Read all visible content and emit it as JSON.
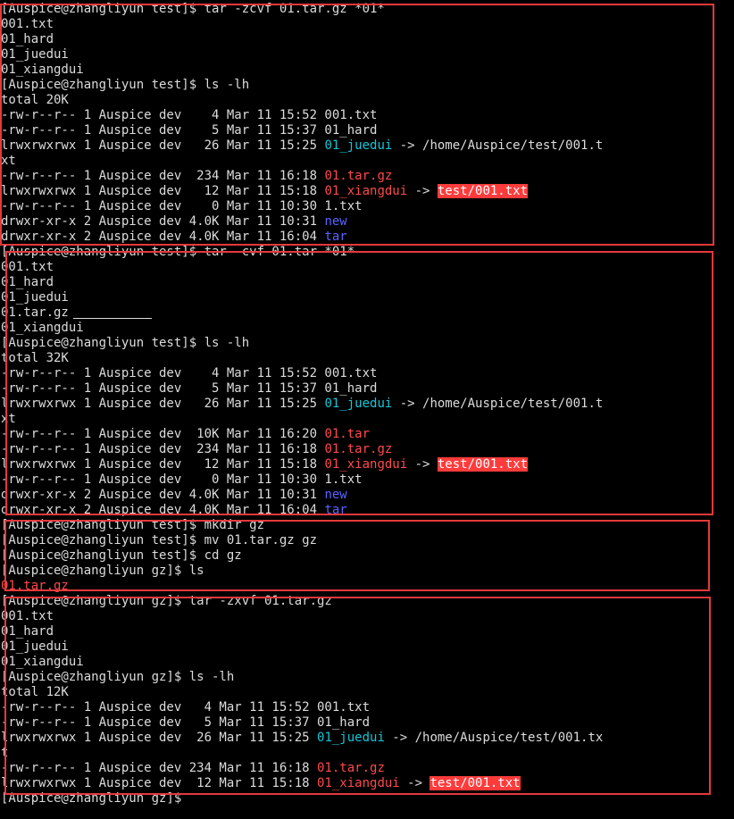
{
  "terminal": {
    "lines": [
      [
        {
          "t": "[Auspice@zhangliyun test]$ tar -zcvf 01.tar.gz *01*"
        }
      ],
      [
        {
          "t": "001.txt"
        }
      ],
      [
        {
          "t": "01_hard"
        }
      ],
      [
        {
          "t": "01_juedui"
        }
      ],
      [
        {
          "t": "01_xiangdui"
        }
      ],
      [
        {
          "t": "[Auspice@zhangliyun test]$ ls -lh"
        }
      ],
      [
        {
          "t": "total 20K"
        }
      ],
      [
        {
          "t": "-rw-r--r-- 1 Auspice dev    4 Mar 11 15:52 001.txt"
        }
      ],
      [
        {
          "t": "-rw-r--r-- 1 Auspice dev    5 Mar 11 15:37 01_hard"
        }
      ],
      [
        {
          "t": "lrwxrwxrwx 1 Auspice dev   26 Mar 11 15:25 "
        },
        {
          "t": "01_juedui",
          "c": "cyan"
        },
        {
          "t": " -> /home/Auspice/test/001.t"
        }
      ],
      [
        {
          "t": "xt"
        }
      ],
      [
        {
          "t": "-rw-r--r-- 1 Auspice dev  234 Mar 11 16:18 "
        },
        {
          "t": "01.tar.gz",
          "c": "red"
        }
      ],
      [
        {
          "t": "lrwxrwxrwx 1 Auspice dev   12 Mar 11 15:18 "
        },
        {
          "t": "01_xiangdui",
          "c": "red"
        },
        {
          "t": " -> "
        },
        {
          "t": "test/001.txt",
          "c": "hl"
        }
      ],
      [
        {
          "t": "-rw-r--r-- 1 Auspice dev    0 Mar 11 10:30 1.txt"
        }
      ],
      [
        {
          "t": "drwxr-xr-x 2 Auspice dev 4.0K Mar 11 10:31 "
        },
        {
          "t": "new",
          "c": "blue"
        }
      ],
      [
        {
          "t": "drwxr-xr-x 2 Auspice dev 4.0K Mar 11 16:04 "
        },
        {
          "t": "tar",
          "c": "blue"
        }
      ],
      [
        {
          "t": "[Auspice@zhangliyun test]$ tar -cvf 01.tar *01*"
        }
      ],
      [
        {
          "t": "001.txt"
        }
      ],
      [
        {
          "t": "01_hard"
        }
      ],
      [
        {
          "t": "01_juedui"
        }
      ],
      [
        {
          "t": "01.tar.gz"
        }
      ],
      [
        {
          "t": "01_xiangdui"
        }
      ],
      [
        {
          "t": "[Auspice@zhangliyun test]$ ls -lh"
        }
      ],
      [
        {
          "t": "total 32K"
        }
      ],
      [
        {
          "t": "-rw-r--r-- 1 Auspice dev    4 Mar 11 15:52 001.txt"
        }
      ],
      [
        {
          "t": "-rw-r--r-- 1 Auspice dev    5 Mar 11 15:37 01_hard"
        }
      ],
      [
        {
          "t": "lrwxrwxrwx 1 Auspice dev   26 Mar 11 15:25 "
        },
        {
          "t": "01_juedui",
          "c": "cyan"
        },
        {
          "t": " -> /home/Auspice/test/001.t"
        }
      ],
      [
        {
          "t": "xt"
        }
      ],
      [
        {
          "t": "-rw-r--r-- 1 Auspice dev  10K Mar 11 16:20 "
        },
        {
          "t": "01.tar",
          "c": "red"
        }
      ],
      [
        {
          "t": "-rw-r--r-- 1 Auspice dev  234 Mar 11 16:18 "
        },
        {
          "t": "01.tar.gz",
          "c": "red"
        }
      ],
      [
        {
          "t": "lrwxrwxrwx 1 Auspice dev   12 Mar 11 15:18 "
        },
        {
          "t": "01_xiangdui",
          "c": "red"
        },
        {
          "t": " -> "
        },
        {
          "t": "test/001.txt",
          "c": "hl"
        }
      ],
      [
        {
          "t": "-rw-r--r-- 1 Auspice dev    0 Mar 11 10:30 1.txt"
        }
      ],
      [
        {
          "t": "drwxr-xr-x 2 Auspice dev 4.0K Mar 11 10:31 "
        },
        {
          "t": "new",
          "c": "blue"
        }
      ],
      [
        {
          "t": "drwxr-xr-x 2 Auspice dev 4.0K Mar 11 16:04 "
        },
        {
          "t": "tar",
          "c": "blue"
        }
      ],
      [
        {
          "t": "[Auspice@zhangliyun test]$ mkdir gz"
        }
      ],
      [
        {
          "t": "[Auspice@zhangliyun test]$ mv 01.tar.gz gz"
        }
      ],
      [
        {
          "t": "[Auspice@zhangliyun test]$ cd gz"
        }
      ],
      [
        {
          "t": "[Auspice@zhangliyun gz]$ ls"
        }
      ],
      [
        {
          "t": "01.tar.gz",
          "c": "red"
        }
      ],
      [
        {
          "t": "[Auspice@zhangliyun gz]$ tar -zxvf 01.tar.gz"
        }
      ],
      [
        {
          "t": "001.txt"
        }
      ],
      [
        {
          "t": "01_hard"
        }
      ],
      [
        {
          "t": "01_juedui"
        }
      ],
      [
        {
          "t": "01_xiangdui"
        }
      ],
      [
        {
          "t": "[Auspice@zhangliyun gz]$ ls -lh"
        }
      ],
      [
        {
          "t": "total 12K"
        }
      ],
      [
        {
          "t": "-rw-r--r-- 1 Auspice dev   4 Mar 11 15:52 001.txt"
        }
      ],
      [
        {
          "t": "-rw-r--r-- 1 Auspice dev   5 Mar 11 15:37 01_hard"
        }
      ],
      [
        {
          "t": "lrwxrwxrwx 1 Auspice dev  26 Mar 11 15:25 "
        },
        {
          "t": "01_juedui",
          "c": "cyan"
        },
        {
          "t": " -> /home/Auspice/test/001.tx"
        }
      ],
      [
        {
          "t": "t"
        }
      ],
      [
        {
          "t": "-rw-r--r-- 1 Auspice dev 234 Mar 11 16:18 "
        },
        {
          "t": "01.tar.gz",
          "c": "red"
        }
      ],
      [
        {
          "t": "lrwxrwxrwx 1 Auspice dev  12 Mar 11 15:18 "
        },
        {
          "t": "01_xiangdui",
          "c": "red"
        },
        {
          "t": " -> "
        },
        {
          "t": "test/001.txt",
          "c": "hl"
        }
      ],
      [
        {
          "t": "[Auspice@zhangliyun gz]$ "
        }
      ]
    ]
  },
  "colors": {
    "background": "#000000",
    "text": "#dcdcdc",
    "symlink": "#15c6d6",
    "archive": "#ff4a4a",
    "directory": "#5a64ff",
    "broken_link_bg": "#ff3b3b",
    "annotation_box": "#e5393b"
  }
}
